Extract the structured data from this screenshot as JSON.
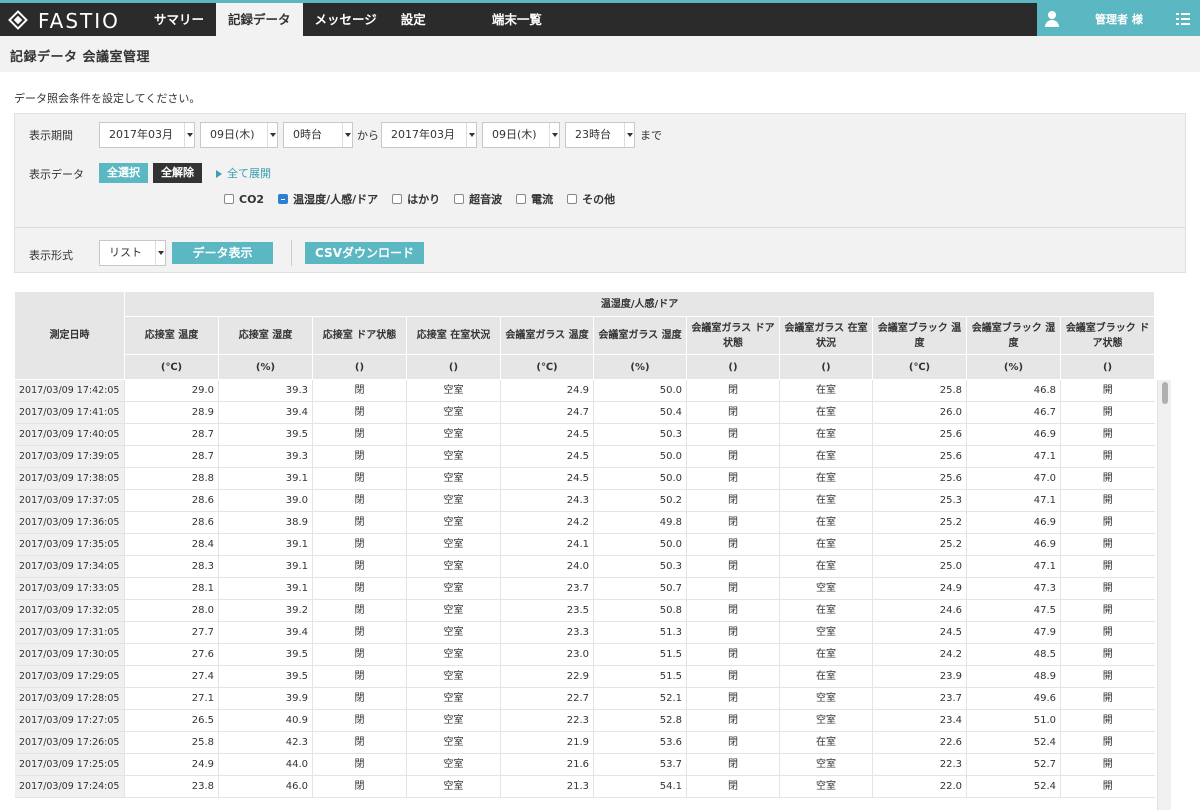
{
  "brand": {
    "name": "FASTIO"
  },
  "nav": [
    "サマリー",
    "記録データ",
    "メッセージ",
    "設定",
    "端末一覧"
  ],
  "user": {
    "name": "管理者 様"
  },
  "page_title": "記録データ 会議室管理",
  "instruction": "データ照会条件を設定してください。",
  "filter": {
    "period_label": "表示期間",
    "from": {
      "month": "2017年03月",
      "day": "09日(木)",
      "hour": "0時台"
    },
    "from_to_text": "から",
    "to": {
      "month": "2017年03月",
      "day": "09日(木)",
      "hour": "23時台"
    },
    "until_text": "まで",
    "data_label": "表示データ",
    "select_all": "全選択",
    "clear_all": "全解除",
    "expand_all": "全て展開",
    "checkboxes": [
      "CO2",
      "温湿度/人感/ドア",
      "はかり",
      "超音波",
      "電流",
      "その他"
    ],
    "format_label": "表示形式",
    "format_value": "リスト",
    "show_data_button": "データ表示",
    "csv_button": "CSVダウンロード"
  },
  "table": {
    "datetime_header": "測定日時",
    "group_header": "温湿度/人感/ドア",
    "columns": [
      {
        "name": "応接室 温度",
        "unit": "(℃)"
      },
      {
        "name": "応接室 湿度",
        "unit": "(%)"
      },
      {
        "name": "応接室 ドア状態",
        "unit": "()"
      },
      {
        "name": "応接室 在室状況",
        "unit": "()"
      },
      {
        "name": "会議室ガラス 温度",
        "unit": "(℃)"
      },
      {
        "name": "会議室ガラス 湿度",
        "unit": "(%)"
      },
      {
        "name": "会議室ガラス ドア状態",
        "unit": "()"
      },
      {
        "name": "会議室ガラス 在室状況",
        "unit": "()"
      },
      {
        "name": "会議室ブラック 温度",
        "unit": "(℃)"
      },
      {
        "name": "会議室ブラック 湿度",
        "unit": "(%)"
      },
      {
        "name": "会議室ブラック ドア状態",
        "unit": "()"
      }
    ],
    "rows": [
      [
        "2017/03/09 17:42:05",
        "29.0",
        "39.3",
        "閉",
        "空室",
        "24.9",
        "50.0",
        "閉",
        "在室",
        "25.8",
        "46.8",
        "開"
      ],
      [
        "2017/03/09 17:41:05",
        "28.9",
        "39.4",
        "閉",
        "空室",
        "24.7",
        "50.4",
        "閉",
        "在室",
        "26.0",
        "46.7",
        "開"
      ],
      [
        "2017/03/09 17:40:05",
        "28.7",
        "39.5",
        "閉",
        "空室",
        "24.5",
        "50.3",
        "閉",
        "在室",
        "25.6",
        "46.9",
        "開"
      ],
      [
        "2017/03/09 17:39:05",
        "28.7",
        "39.3",
        "閉",
        "空室",
        "24.5",
        "50.0",
        "閉",
        "在室",
        "25.6",
        "47.1",
        "開"
      ],
      [
        "2017/03/09 17:38:05",
        "28.8",
        "39.1",
        "閉",
        "空室",
        "24.5",
        "50.0",
        "閉",
        "在室",
        "25.6",
        "47.0",
        "開"
      ],
      [
        "2017/03/09 17:37:05",
        "28.6",
        "39.0",
        "閉",
        "空室",
        "24.3",
        "50.2",
        "閉",
        "在室",
        "25.3",
        "47.1",
        "開"
      ],
      [
        "2017/03/09 17:36:05",
        "28.6",
        "38.9",
        "閉",
        "空室",
        "24.2",
        "49.8",
        "閉",
        "在室",
        "25.2",
        "46.9",
        "開"
      ],
      [
        "2017/03/09 17:35:05",
        "28.4",
        "39.1",
        "閉",
        "空室",
        "24.1",
        "50.0",
        "閉",
        "在室",
        "25.2",
        "46.9",
        "開"
      ],
      [
        "2017/03/09 17:34:05",
        "28.3",
        "39.1",
        "閉",
        "空室",
        "24.0",
        "50.3",
        "閉",
        "在室",
        "25.0",
        "47.1",
        "開"
      ],
      [
        "2017/03/09 17:33:05",
        "28.1",
        "39.1",
        "閉",
        "空室",
        "23.7",
        "50.7",
        "閉",
        "空室",
        "24.9",
        "47.3",
        "開"
      ],
      [
        "2017/03/09 17:32:05",
        "28.0",
        "39.2",
        "閉",
        "空室",
        "23.5",
        "50.8",
        "閉",
        "在室",
        "24.6",
        "47.5",
        "開"
      ],
      [
        "2017/03/09 17:31:05",
        "27.7",
        "39.4",
        "閉",
        "空室",
        "23.3",
        "51.3",
        "閉",
        "空室",
        "24.5",
        "47.9",
        "開"
      ],
      [
        "2017/03/09 17:30:05",
        "27.6",
        "39.5",
        "閉",
        "空室",
        "23.0",
        "51.5",
        "閉",
        "在室",
        "24.2",
        "48.5",
        "開"
      ],
      [
        "2017/03/09 17:29:05",
        "27.4",
        "39.5",
        "閉",
        "空室",
        "22.9",
        "51.5",
        "閉",
        "在室",
        "23.9",
        "48.9",
        "開"
      ],
      [
        "2017/03/09 17:28:05",
        "27.1",
        "39.9",
        "閉",
        "空室",
        "22.7",
        "52.1",
        "閉",
        "空室",
        "23.7",
        "49.6",
        "開"
      ],
      [
        "2017/03/09 17:27:05",
        "26.5",
        "40.9",
        "閉",
        "空室",
        "22.3",
        "52.8",
        "閉",
        "空室",
        "23.4",
        "51.0",
        "開"
      ],
      [
        "2017/03/09 17:26:05",
        "25.8",
        "42.3",
        "閉",
        "空室",
        "21.9",
        "53.6",
        "閉",
        "在室",
        "22.6",
        "52.4",
        "開"
      ],
      [
        "2017/03/09 17:25:05",
        "24.9",
        "44.0",
        "閉",
        "空室",
        "21.6",
        "53.7",
        "閉",
        "空室",
        "22.3",
        "52.7",
        "開"
      ],
      [
        "2017/03/09 17:24:05",
        "23.8",
        "46.0",
        "閉",
        "空室",
        "21.3",
        "54.1",
        "閉",
        "空室",
        "22.0",
        "52.4",
        "開"
      ]
    ]
  }
}
